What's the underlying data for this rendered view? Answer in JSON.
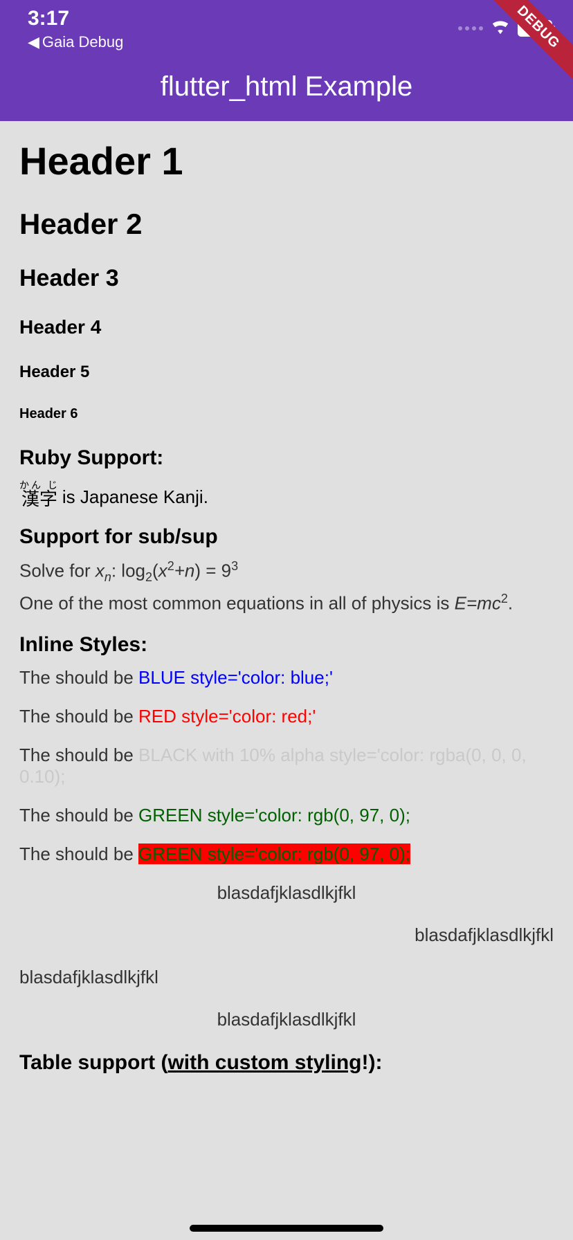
{
  "statusBar": {
    "time": "3:17",
    "backNav": "Gaia Debug"
  },
  "debugBanner": "DEBUG",
  "appBar": {
    "title": "flutter_html Example"
  },
  "headers": {
    "h1": "Header 1",
    "h2": "Header 2",
    "h3": "Header 3",
    "h4": "Header 4",
    "h5": "Header 5",
    "h6": "Header 6"
  },
  "ruby": {
    "sectionTitle": "Ruby Support:",
    "rubyTop": "かん じ",
    "rubyBase": "漢字",
    "rest": " is Japanese Kanji."
  },
  "subsup": {
    "sectionTitle": "Support for sub/sup",
    "line1_solve": "Solve for ",
    "line1_xn_x": "x",
    "line1_xn_n": "n",
    "line1_log": ": log",
    "line1_log2": "2",
    "line1_paren": "(",
    "line1_x": "x",
    "line1_sq": "2",
    "line1_plusn": "+n",
    "line1_closep": ") = 9",
    "line1_nine3": "3",
    "line2_text": "One of the most common equations in all of physics is ",
    "line2_emc": "E=mc",
    "line2_sq": "2",
    "line2_period": "."
  },
  "inlineStyles": {
    "sectionTitle": "Inline Styles:",
    "prefix": "The should be ",
    "blue": "BLUE style='color: blue;'",
    "red": "RED style='color: red;'",
    "black10": "BLACK with 10% alpha style='color: rgba(0, 0, 0, 0.10);",
    "green1": "GREEN style='color: rgb(0, 97, 0);",
    "green2": "GREEN style='color: rgb(0, 97, 0);"
  },
  "aligned": {
    "text": "blasdafjklasdlkjfkl"
  },
  "tableSection": {
    "titlePrefix": "Table support (",
    "titleUnderline": "with custom styling",
    "titleSuffix": "!):"
  }
}
